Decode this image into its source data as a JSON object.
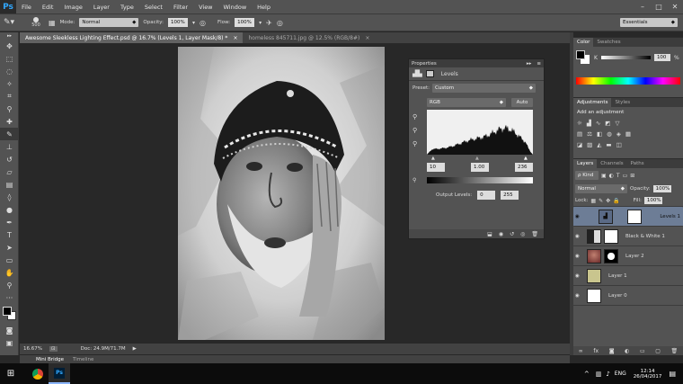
{
  "app": {
    "logo": "Ps",
    "menu": [
      "File",
      "Edit",
      "Image",
      "Layer",
      "Type",
      "Select",
      "Filter",
      "View",
      "Window",
      "Help"
    ],
    "win_min": "–",
    "win_max": "□",
    "win_close": "✕"
  },
  "options": {
    "brush_size": "500",
    "mode_label": "Mode:",
    "mode": "Normal",
    "opacity_label": "Opacity:",
    "opacity": "100%",
    "flow_label": "Flow:",
    "flow": "100%",
    "workspace": "Essentials"
  },
  "tabs": [
    {
      "label": "Awesome Sleekless Lighting Effect.psd @ 16.7% (Levels 1, Layer Mask/8) *",
      "close": "×"
    },
    {
      "label": "homeless 845711.jpg @ 12.5% (RGB/8#)",
      "close": "×"
    }
  ],
  "status": {
    "zoom": "16.67%",
    "doc": "Doc: 24.9M/71.7M",
    "arrow": "▶"
  },
  "bottom_tabs": [
    "Mini Bridge",
    "Timeline"
  ],
  "properties": {
    "title": "Properties",
    "collapse": "▸▸",
    "menu": "≡",
    "heading": "Levels",
    "preset_label": "Preset:",
    "preset": "Custom",
    "channel": "RGB",
    "auto": "Auto",
    "input_black": "10",
    "input_mid": "1.00",
    "input_white": "236",
    "output_label": "Output Levels:",
    "output_black": "0",
    "output_white": "255"
  },
  "color_panel": {
    "tabs": [
      "Color",
      "Swatches"
    ],
    "k_label": "K",
    "k_value": "100",
    "k_unit": "%"
  },
  "adjustments": {
    "tabs": [
      "Adjustments",
      "Styles"
    ],
    "add": "Add an adjustment"
  },
  "layers": {
    "tabs": [
      "Layers",
      "Channels",
      "Paths"
    ],
    "kind": "ρ Kind",
    "blend": "Normal",
    "opacity_label": "Opacity:",
    "opacity": "100%",
    "lock_label": "Lock:",
    "fill_label": "Fill:",
    "fill": "100%",
    "items": [
      {
        "name": "Levels 1",
        "selected": true
      },
      {
        "name": "Black & White 1",
        "selected": false
      },
      {
        "name": "Layer 2",
        "selected": false
      },
      {
        "name": "Layer 1",
        "selected": false
      },
      {
        "name": "Layer 0",
        "selected": false
      }
    ]
  },
  "taskbar": {
    "lang": "ENG",
    "time": "12:14",
    "date": "26/04/2017",
    "chevron": "^"
  },
  "colors": {
    "ui": "#535353",
    "dark": "#3c3c3c",
    "accent": "#31a8ff",
    "selected_layer": "#6d7d96"
  }
}
